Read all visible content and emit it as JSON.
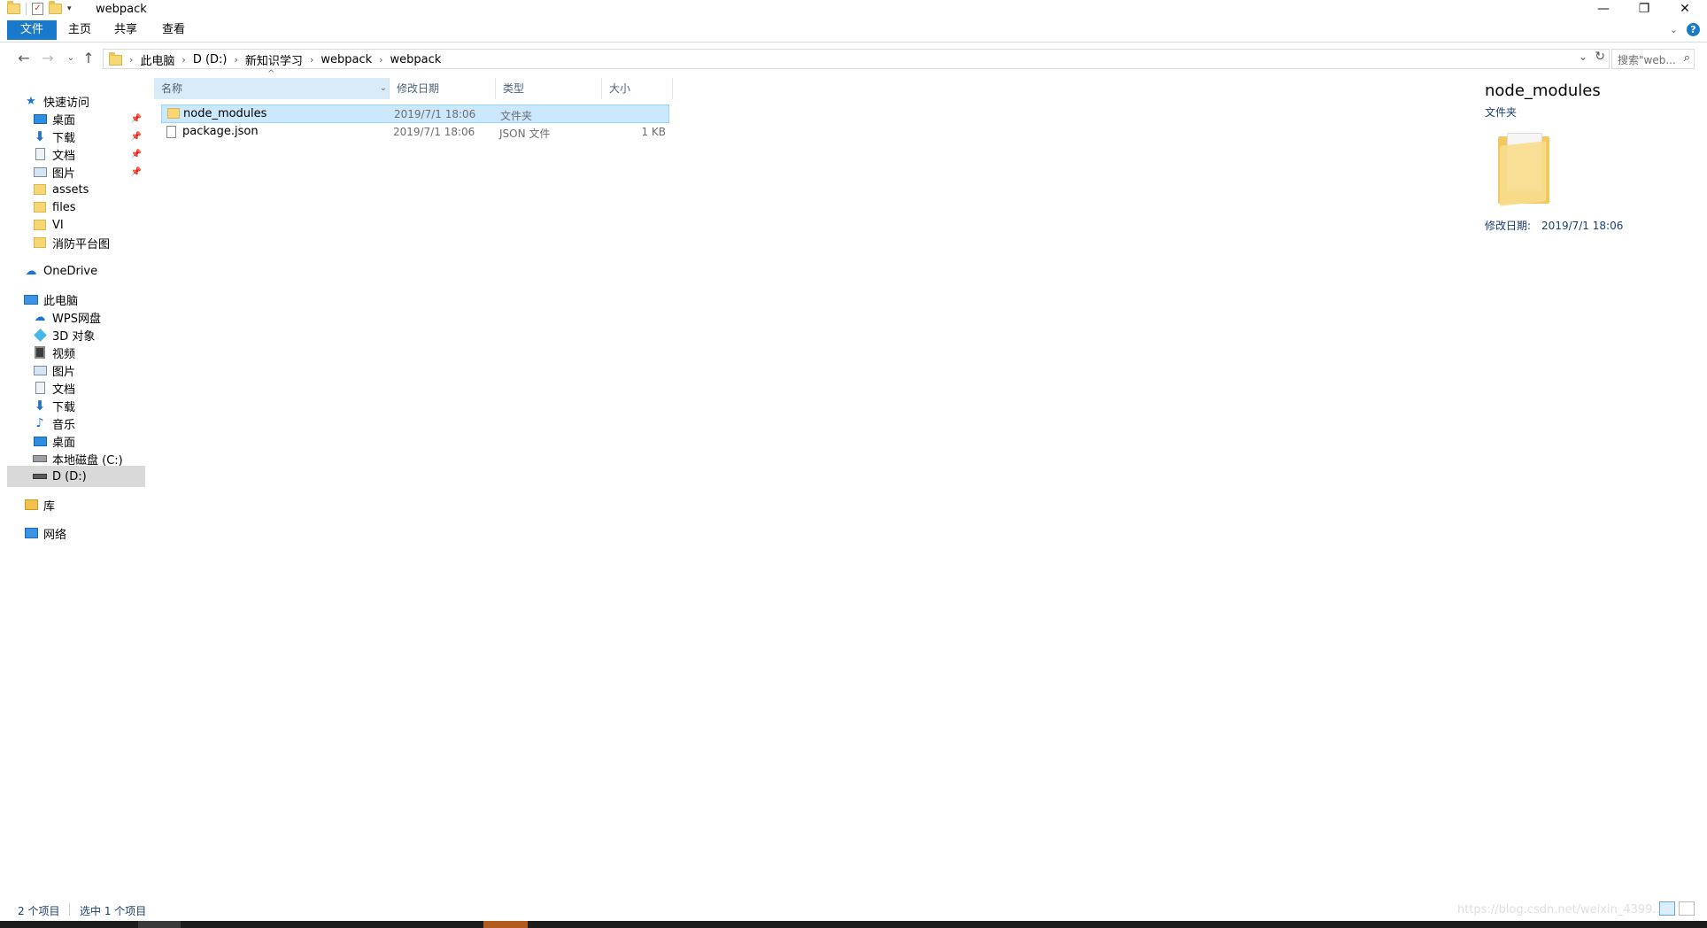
{
  "window": {
    "title": "webpack",
    "controls": {
      "minimize": "—",
      "restore": "❐",
      "close": "✕"
    }
  },
  "ribbon": {
    "tabs": [
      "文件",
      "主页",
      "共享",
      "查看"
    ]
  },
  "addressbar": {
    "crumbs": [
      "此电脑",
      "D (D:)",
      "新知识学习",
      "webpack",
      "webpack"
    ],
    "search_placeholder": "搜索\"web..."
  },
  "navpane": {
    "items": [
      {
        "label": "快速访问",
        "icon": "star-icon",
        "pinned": false
      },
      {
        "label": "桌面",
        "icon": "desktop-icon",
        "pinned": true
      },
      {
        "label": "下载",
        "icon": "download-icon",
        "pinned": true
      },
      {
        "label": "文档",
        "icon": "document-icon",
        "pinned": true
      },
      {
        "label": "图片",
        "icon": "picture-icon",
        "pinned": true
      },
      {
        "label": "assets",
        "icon": "folder-icon",
        "pinned": false
      },
      {
        "label": "files",
        "icon": "folder-icon",
        "pinned": false
      },
      {
        "label": "VI",
        "icon": "folder-icon",
        "pinned": false
      },
      {
        "label": "消防平台图",
        "icon": "folder-icon",
        "pinned": false
      },
      {
        "label": "OneDrive",
        "icon": "cloud-icon",
        "pinned": false
      },
      {
        "label": "此电脑",
        "icon": "computer-icon",
        "pinned": false
      },
      {
        "label": "WPS网盘",
        "icon": "cloud-icon",
        "pinned": false
      },
      {
        "label": "3D 对象",
        "icon": "3d-objects-icon",
        "pinned": false
      },
      {
        "label": "视频",
        "icon": "video-icon",
        "pinned": false
      },
      {
        "label": "图片",
        "icon": "picture-icon",
        "pinned": false
      },
      {
        "label": "文档",
        "icon": "document-icon",
        "pinned": false
      },
      {
        "label": "下载",
        "icon": "download-icon",
        "pinned": false
      },
      {
        "label": "音乐",
        "icon": "music-icon",
        "pinned": false
      },
      {
        "label": "桌面",
        "icon": "desktop-icon",
        "pinned": false
      },
      {
        "label": "本地磁盘 (C:)",
        "icon": "local-disk-icon",
        "pinned": false
      },
      {
        "label": "D (D:)",
        "icon": "drive-icon",
        "pinned": false,
        "selected": true
      },
      {
        "label": "库",
        "icon": "library-icon",
        "pinned": false
      },
      {
        "label": "网络",
        "icon": "network-icon",
        "pinned": false
      }
    ]
  },
  "filelist": {
    "columns": {
      "name": "名称",
      "date": "修改日期",
      "type": "类型",
      "size": "大小"
    },
    "rows": [
      {
        "name": "node_modules",
        "date": "2019/7/1 18:06",
        "type": "文件夹",
        "size": "",
        "selected": true,
        "icon": "folder-icon"
      },
      {
        "name": "package.json",
        "date": "2019/7/1 18:06",
        "type": "JSON 文件",
        "size": "1 KB",
        "selected": false,
        "icon": "file-icon"
      }
    ]
  },
  "preview": {
    "title": "node_modules",
    "subtitle": "文件夹",
    "meta_label": "修改日期:",
    "meta_value": "2019/7/1 18:06"
  },
  "statusbar": {
    "item_count": "2 个项目",
    "selected": "选中 1 个项目",
    "watermark": "https://blog.csdn.net/weixin_4399..."
  },
  "colors": {
    "accent": "#1979ca",
    "selection_bg": "#cce8ff",
    "selection_border": "#99d1ff",
    "header_bg": "#d9ebf9"
  }
}
